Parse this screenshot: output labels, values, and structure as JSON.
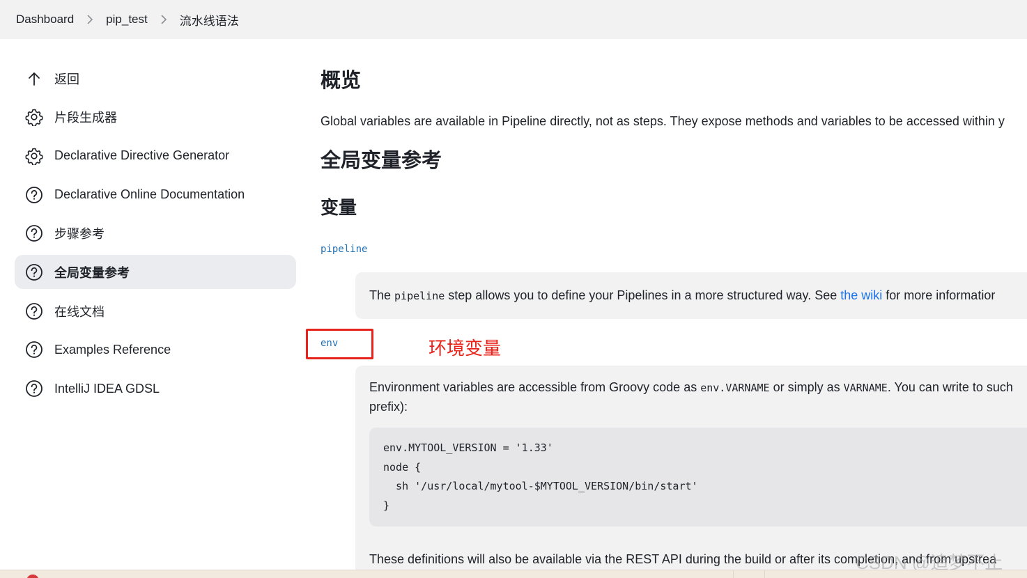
{
  "breadcrumb": [
    "Dashboard",
    "pip_test",
    "流水线语法"
  ],
  "sidebar": {
    "items": [
      {
        "label": "返回",
        "icon": "arrow-up-icon"
      },
      {
        "label": "片段生成器",
        "icon": "gear-icon"
      },
      {
        "label": "Declarative Directive Generator",
        "icon": "gear-icon"
      },
      {
        "label": "Declarative Online Documentation",
        "icon": "help-circle-icon"
      },
      {
        "label": "步骤参考",
        "icon": "help-circle-icon"
      },
      {
        "label": "全局变量参考",
        "icon": "help-circle-icon",
        "active": true
      },
      {
        "label": "在线文档",
        "icon": "help-circle-icon"
      },
      {
        "label": "Examples Reference",
        "icon": "help-circle-icon"
      },
      {
        "label": "IntelliJ IDEA GDSL",
        "icon": "help-circle-icon"
      }
    ]
  },
  "main": {
    "overview_heading": "概览",
    "intro": "Global variables are available in Pipeline directly, not as steps. They expose methods and variables to be accessed within y",
    "global_heading": "全局变量参考",
    "vars_heading": "变量",
    "pipeline": {
      "name": "pipeline",
      "desc_pre": "The ",
      "desc_code": "pipeline",
      "desc_mid": " step allows you to define your Pipelines in a more structured way. See ",
      "desc_link": "the wiki",
      "desc_post": " for more informatior"
    },
    "env": {
      "name": "env",
      "desc_1": "Environment variables are accessible from Groovy code as ",
      "desc_code_1": "env.VARNAME",
      "desc_2": " or simply as ",
      "desc_code_2": "VARNAME",
      "desc_3": ". You can write to such",
      "desc_line2": "prefix):",
      "code": "env.MYTOOL_VERSION = '1.33'\nnode {\n  sh '/usr/local/mytool-$MYTOOL_VERSION/bin/start'\n}",
      "rest": "These definitions will also be available via the REST API during the build or after its completion, and from upstrea"
    }
  },
  "annotation": {
    "label": "环境变量",
    "color": "#e8231b"
  },
  "watermark": "CSDN @追梦不止",
  "colors": {
    "link": "#1f6fb5",
    "active_bg": "#ebecef",
    "annotation": "#e8231b"
  }
}
